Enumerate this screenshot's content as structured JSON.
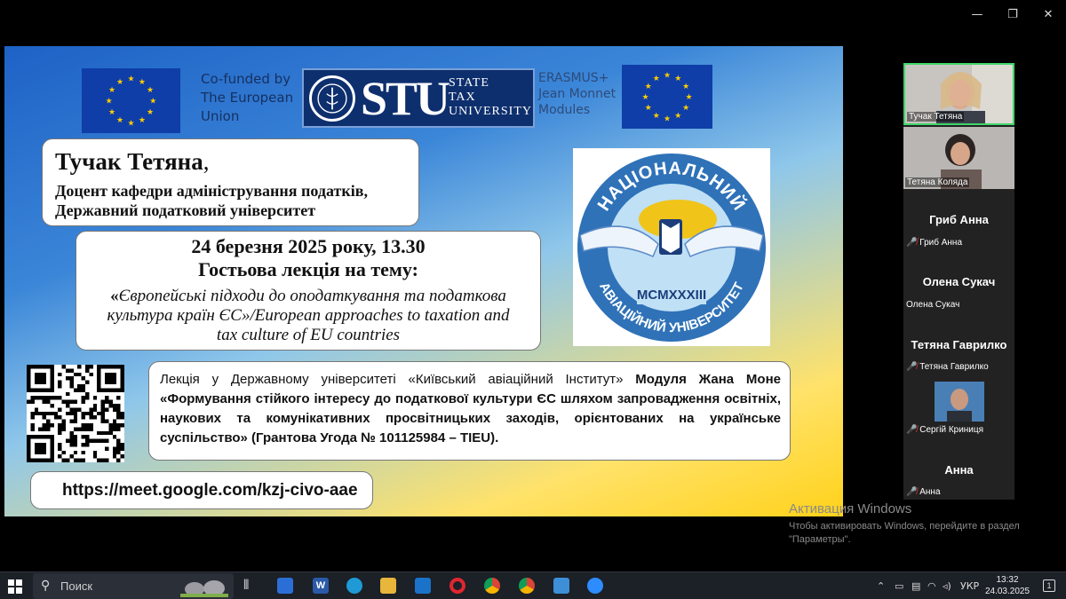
{
  "window": {
    "minimize": "—",
    "restore": "❐",
    "close": "✕"
  },
  "slide": {
    "cofunded": [
      "Co-funded by",
      "The European",
      "Union"
    ],
    "stu_logo": {
      "big": "STU",
      "lines": [
        "STATE",
        "TAX",
        "UNIVERSITY"
      ]
    },
    "erasmus": [
      "ERASMUS+",
      "Jean Monnet",
      "Modules"
    ],
    "speaker": {
      "name": "Тучак Тетяна",
      "name_suffix": ",",
      "position_line1": "Доцент кафедри адміністрування податків,",
      "position_line2": "Державний податковий університет"
    },
    "lecture": {
      "date": "24 березня 2025 року, 13.30",
      "heading": "Гостьова лекція на тему:",
      "topic_open": "«",
      "topic_line1": "Європейські підходи до оподаткування та податкова",
      "topic_line2": "культура країн ЄС»/European approaches to taxation and",
      "topic_line3": "tax culture of EU countries"
    },
    "university_logo": {
      "top": "НАЦІОНАЛЬНИЙ",
      "bottom": "АВІАЦІЙНИЙ УНІВЕРСИТЕТ",
      "year": "MCMXXXIII"
    },
    "info": {
      "part1": "Лекція у Державному університеті «Київський авіаційний Інститут» ",
      "part_bold1": "Модуля Жана Моне",
      "part_bold2": "«Формування стійкого інтересу до податкової культури ЄС шляхом запровадження освітніх, наукових та комунікативних просвітницьких заходів, орієнтованих на українське суспільство» (Грантова Угода №  101125984 – TIEU)."
    },
    "meet_link": "https://meet.google.com/kzj-civo-aae"
  },
  "participants": [
    {
      "name": "Тучак Тетяна",
      "type": "video",
      "active": true
    },
    {
      "name": "Тетяна Коляда",
      "type": "video",
      "active": false
    },
    {
      "display": "Гриб Анна",
      "name": "Гриб Анна",
      "type": "name",
      "muted": true
    },
    {
      "display": "Олена Сукач",
      "name": "Олена Сукач",
      "type": "name",
      "muted": false
    },
    {
      "display": "Тетяна Гаврилко",
      "name": "Тетяна Гаврилко",
      "type": "name",
      "muted": true
    },
    {
      "name": "Сергій Криниця",
      "type": "avatar",
      "muted": true
    },
    {
      "display": "Анна",
      "name": "Анна",
      "type": "name",
      "muted": true
    }
  ],
  "activation": {
    "title": "Активация Windows",
    "line1": "Чтобы активировать Windows, перейдите в раздел",
    "line2": "\"Параметры\"."
  },
  "taskbar": {
    "search_placeholder": "Поиск",
    "icons": [
      "task-view",
      "store",
      "word",
      "edge",
      "explorer",
      "outlook",
      "opera",
      "chrome",
      "chrome-profile",
      "photos",
      "zoom"
    ],
    "tray_lang": "УКР",
    "time": "13:32",
    "date": "24.03.2025",
    "notifications": "1"
  },
  "colors": {
    "accent_green": "#3fd56a",
    "eu_blue": "#0f3ea8",
    "eu_star": "#ffcc00"
  }
}
